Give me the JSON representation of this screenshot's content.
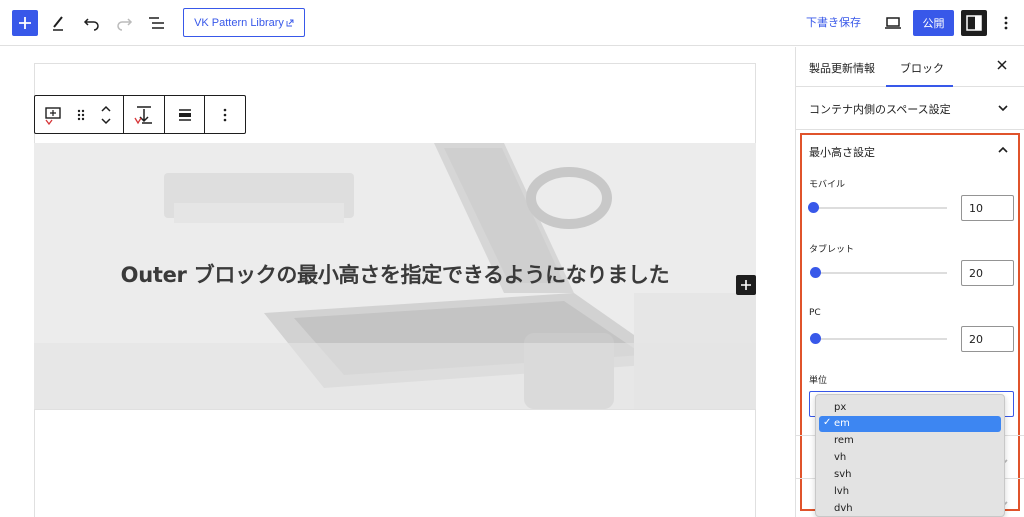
{
  "topbar": {
    "pattern_library": "VK Pattern Library",
    "save_draft": "下書き保存",
    "publish": "公開"
  },
  "canvas": {
    "cover_title": "Outer ブロックの最小高さを指定できるようになりました"
  },
  "sidebar": {
    "tabs": [
      "製品更新情報",
      "ブロック"
    ],
    "active_tab": "ブロック",
    "padding_panel": "コンテナ内側のスペース設定",
    "min_height_panel": "最小高さ設定",
    "fields": [
      {
        "label": "モバイル",
        "value": "10",
        "fraction": 0.0
      },
      {
        "label": "タブレット",
        "value": "20",
        "fraction": 0.02
      },
      {
        "label": "PC",
        "value": "20",
        "fraction": 0.02
      }
    ],
    "unit_label": "単位"
  },
  "dropdown": {
    "options": [
      "px",
      "em",
      "rem",
      "vh",
      "svh",
      "lvh",
      "dvh"
    ],
    "selected": "em"
  },
  "colors": {
    "accent": "#3858e9",
    "highlight_border": "#e0532b",
    "dropdown_selected": "#3d86f2"
  }
}
